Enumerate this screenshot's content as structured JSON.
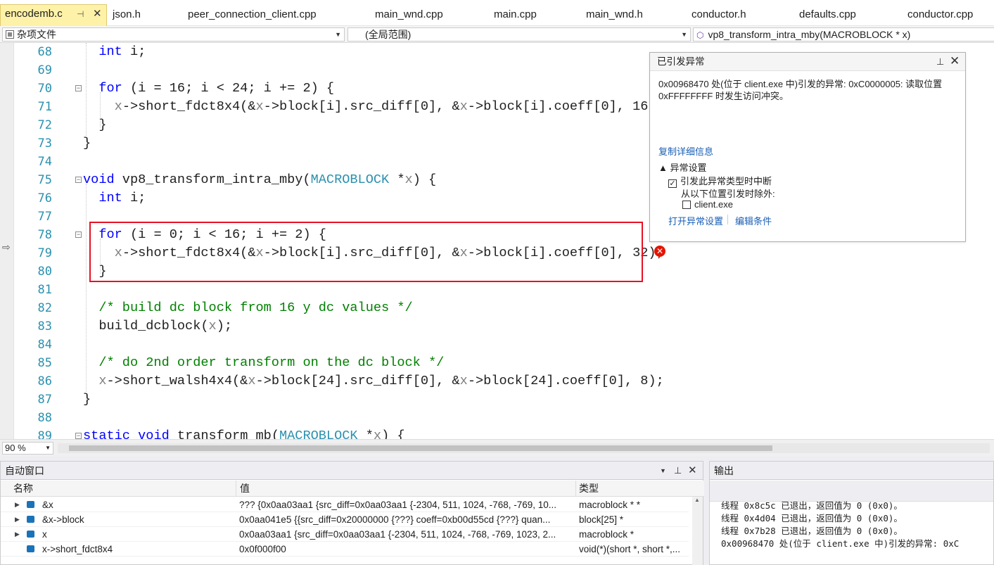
{
  "tabs": [
    {
      "label": "encodemb.c",
      "active": true
    },
    {
      "label": "json.h"
    },
    {
      "label": "peer_connection_client.cpp"
    },
    {
      "label": "main_wnd.cpp"
    },
    {
      "label": "main.cpp"
    },
    {
      "label": "main_wnd.h"
    },
    {
      "label": "conductor.h"
    },
    {
      "label": "defaults.cpp"
    },
    {
      "label": "conductor.cpp"
    }
  ],
  "tab_icons": {
    "pin": "⊣",
    "close": "✕"
  },
  "navbar": {
    "project": "杂项文件",
    "scope": "(全局范围)",
    "member": "vp8_transform_intra_mby(MACROBLOCK * x)"
  },
  "code": {
    "lines": [
      {
        "n": "68",
        "parts": [
          [
            "",
            "  "
          ],
          [
            "kw",
            "int"
          ],
          [
            "",
            " i;"
          ]
        ]
      },
      {
        "n": "69",
        "parts": []
      },
      {
        "n": "70",
        "parts": [
          [
            "",
            "  "
          ],
          [
            "kw",
            "for"
          ],
          [
            "",
            " (i = 16; i < 24; i += 2) {"
          ]
        ]
      },
      {
        "n": "71",
        "parts": [
          [
            "",
            "    "
          ],
          [
            "pm",
            "x"
          ],
          [
            "",
            "->short_fdct8x4(&"
          ],
          [
            "pm",
            "x"
          ],
          [
            "",
            "->block[i].src_diff[0], &"
          ],
          [
            "pm",
            "x"
          ],
          [
            "",
            "->block[i].coeff[0], 16);"
          ]
        ]
      },
      {
        "n": "72",
        "parts": [
          [
            "",
            "  }"
          ]
        ]
      },
      {
        "n": "73",
        "parts": [
          [
            "",
            "}"
          ]
        ]
      },
      {
        "n": "74",
        "parts": []
      },
      {
        "n": "75",
        "parts": [
          [
            "kw",
            "void"
          ],
          [
            "",
            " vp8_transform_intra_mby("
          ],
          [
            "ty",
            "MACROBLOCK"
          ],
          [
            "",
            " *"
          ],
          [
            "pm",
            "x"
          ],
          [
            "",
            ") {"
          ]
        ]
      },
      {
        "n": "76",
        "parts": [
          [
            "",
            "  "
          ],
          [
            "kw",
            "int"
          ],
          [
            "",
            " i;"
          ]
        ]
      },
      {
        "n": "77",
        "parts": []
      },
      {
        "n": "78",
        "parts": [
          [
            "",
            "  "
          ],
          [
            "kw",
            "for"
          ],
          [
            "",
            " (i = 0; i < 16; i += 2) {"
          ]
        ]
      },
      {
        "n": "79",
        "parts": [
          [
            "",
            "    "
          ],
          [
            "pm",
            "x"
          ],
          [
            "",
            "->short_fdct8x4(&"
          ],
          [
            "pm",
            "x"
          ],
          [
            "",
            "->block[i].src_diff[0], &"
          ],
          [
            "pm",
            "x"
          ],
          [
            "",
            "->block[i].coeff[0], 32);"
          ]
        ]
      },
      {
        "n": "80",
        "parts": [
          [
            "",
            "  }"
          ]
        ]
      },
      {
        "n": "81",
        "parts": []
      },
      {
        "n": "82",
        "parts": [
          [
            "",
            "  "
          ],
          [
            "cm",
            "/* build dc block from 16 y dc values */"
          ]
        ]
      },
      {
        "n": "83",
        "parts": [
          [
            "",
            "  build_dcblock("
          ],
          [
            "pm",
            "x"
          ],
          [
            "",
            ");"
          ]
        ]
      },
      {
        "n": "84",
        "parts": []
      },
      {
        "n": "85",
        "parts": [
          [
            "",
            "  "
          ],
          [
            "cm",
            "/* do 2nd order transform on the dc block */"
          ]
        ]
      },
      {
        "n": "86",
        "parts": [
          [
            "",
            "  "
          ],
          [
            "pm",
            "x"
          ],
          [
            "",
            "->short_walsh4x4(&"
          ],
          [
            "pm",
            "x"
          ],
          [
            "",
            "->block[24].src_diff[0], &"
          ],
          [
            "pm",
            "x"
          ],
          [
            "",
            "->block[24].coeff[0], 8);"
          ]
        ]
      },
      {
        "n": "87",
        "parts": [
          [
            "",
            "}"
          ]
        ]
      },
      {
        "n": "88",
        "parts": []
      },
      {
        "n": "89",
        "parts": [
          [
            "kw",
            "static"
          ],
          [
            "",
            " "
          ],
          [
            "kw",
            "void"
          ],
          [
            "",
            " transform_mb("
          ],
          [
            "ty",
            "MACROBLOCK"
          ],
          [
            "",
            " *"
          ],
          [
            "pm",
            "x"
          ],
          [
            "",
            ") {"
          ]
        ]
      }
    ]
  },
  "exception": {
    "title": "已引发异常",
    "message": "0x00968470 处(位于 client.exe 中)引发的异常: 0xC0000005: 读取位置 0xFFFFFFFF 时发生访问冲突。",
    "copy_details": "复制详细信息",
    "settings_header": "▲ 异常设置",
    "break_when_thrown": "引发此异常类型时中断",
    "except_when_from": "从以下位置引发时除外:",
    "module": "client.exe",
    "open_settings": "打开异常设置",
    "edit_conditions": "编辑条件",
    "break_checked": true,
    "module_checked": false
  },
  "zoom": "90 %",
  "autos": {
    "title": "自动窗口",
    "columns": [
      "名称",
      "值",
      "类型"
    ],
    "rows": [
      {
        "name": "&x",
        "value": "??? {0x0aa03aa1 {src_diff=0x0aa03aa1 {-2304, 511, 1024, -768, -769, 10...",
        "type": "macroblock * *",
        "expandable": true
      },
      {
        "name": "&x->block",
        "value": "0x0aa041e5 {{src_diff=0x20000000 {???} coeff=0xb00d55cd {???} quan...",
        "type": "block[25] *",
        "expandable": true
      },
      {
        "name": "x",
        "value": "0x0aa03aa1 {src_diff=0x0aa03aa1 {-2304, 511, 1024, -768, -769, 1023, 2...",
        "type": "macroblock *",
        "expandable": true
      },
      {
        "name": "x->short_fdct8x4",
        "value": "0x0f000f00",
        "type": "void(*)(short *, short *,...",
        "expandable": false
      }
    ]
  },
  "output": {
    "title": "输出",
    "lines": [
      "线程 0x8c5c 已退出，返回值为 0 (0x0)。",
      "线程 0x4d04 已退出，返回值为 0 (0x0)。",
      "线程 0x7b28 已退出，返回值为 0 (0x0)。",
      "0x00968470 处(位于 client.exe 中)引发的异常: 0xC"
    ]
  }
}
